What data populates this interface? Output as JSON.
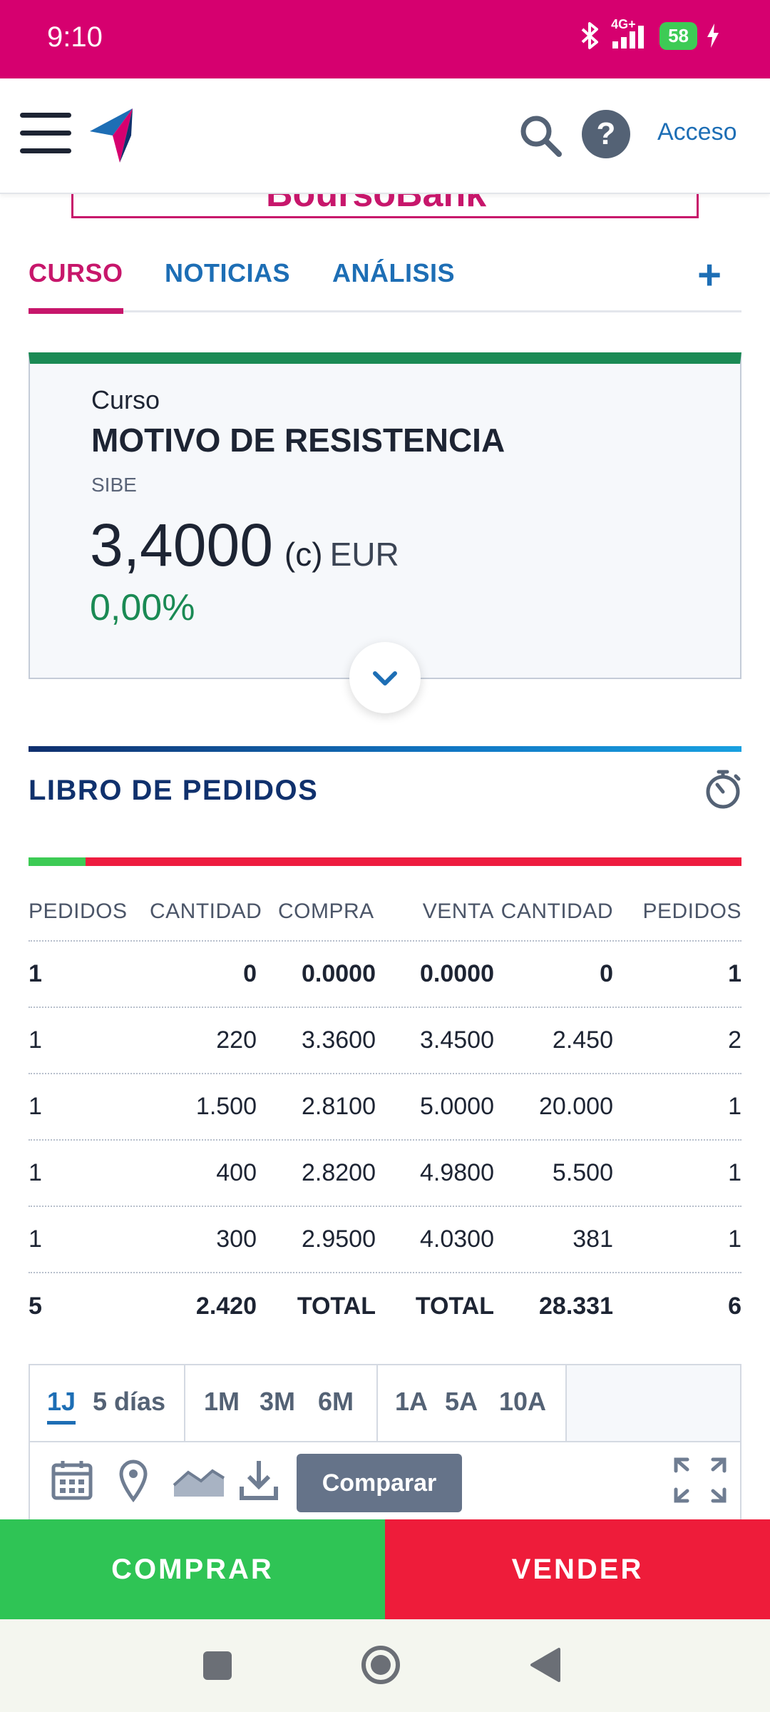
{
  "status_bar": {
    "time": "9:10",
    "network": "4G+",
    "battery": "58"
  },
  "nav": {
    "login_label": "Acceso",
    "help_symbol": "?"
  },
  "banner": {
    "text": "BoursoBank"
  },
  "tabs": [
    {
      "label": "CURSO",
      "active": true
    },
    {
      "label": "NOTICIAS",
      "active": false
    },
    {
      "label": "ANÁLISIS",
      "active": false
    }
  ],
  "tab_more": "+",
  "quote": {
    "label": "Curso",
    "name": "MOTIVO DE RESISTENCIA",
    "market": "SIBE",
    "price": "3,4000",
    "qualifier": "(c)",
    "currency": "EUR",
    "change": "0,00%"
  },
  "order_book": {
    "title": "LIBRO DE PEDIDOS",
    "buy_ratio": 0.08,
    "columns": [
      "PEDIDOS",
      "CANTIDAD",
      "COMPRA",
      "VENTA",
      "CANTIDAD",
      "PEDIDOS"
    ],
    "rows": [
      [
        "1",
        "0",
        "0.0000",
        "0.0000",
        "0",
        "1"
      ],
      [
        "1",
        "220",
        "3.3600",
        "3.4500",
        "2.450",
        "2"
      ],
      [
        "1",
        "1.500",
        "2.8100",
        "5.0000",
        "20.000",
        "1"
      ],
      [
        "1",
        "400",
        "2.8200",
        "4.9800",
        "5.500",
        "1"
      ],
      [
        "1",
        "300",
        "2.9500",
        "4.0300",
        "381",
        "1"
      ]
    ],
    "totals": [
      "5",
      "2.420",
      "TOTAL",
      "TOTAL",
      "28.331",
      "6"
    ]
  },
  "chart_toolbar": {
    "periods": [
      "1J",
      "5 días",
      "1M",
      "3M",
      "6M",
      "1A",
      "5A",
      "10A"
    ],
    "active_period": "1J",
    "compare_label": "Comparar"
  },
  "actions": {
    "buy_label": "COMPRAR",
    "sell_label": "VENDER"
  },
  "icons": {
    "menu": "hamburger-icon",
    "logo": "brand-logo",
    "search": "search-icon",
    "help": "help-icon",
    "expand": "chevron-down-icon",
    "timer": "stopwatch-icon",
    "calendar": "calendar-icon",
    "marker": "map-pin-icon",
    "chart_type": "area-chart-icon",
    "download": "download-icon",
    "fullscreen": "fullscreen-icon"
  },
  "colors": {
    "brand": "#d6006f",
    "accent": "#1d6eb5",
    "positive": "#1a8a54",
    "buy": "#2fc455",
    "sell": "#ee1c3a"
  }
}
